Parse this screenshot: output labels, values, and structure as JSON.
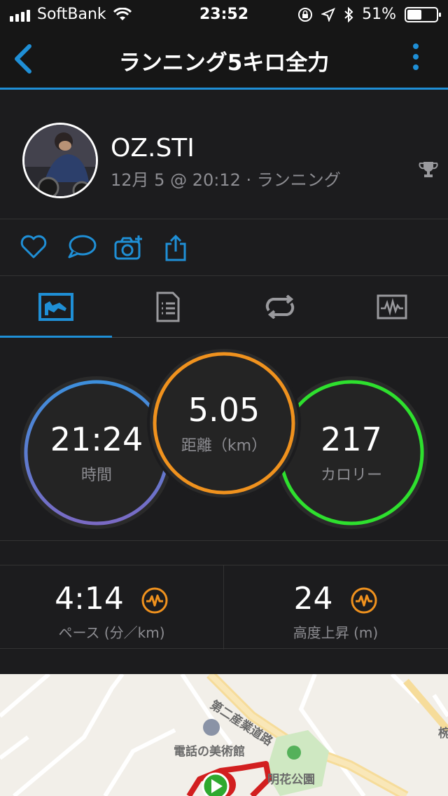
{
  "status_bar": {
    "carrier": "SoftBank",
    "time": "23:52",
    "battery_percent": "51%",
    "battery_level": 0.51
  },
  "nav": {
    "title": "ランニング5キロ全力"
  },
  "profile": {
    "name": "OZ.STI",
    "activity_meta": "12月 5 @ 20:12 · ランニング"
  },
  "tabs": [
    "summary-chart",
    "details",
    "laps",
    "graphs"
  ],
  "metrics": {
    "time": {
      "value": "21:24",
      "label": "時間"
    },
    "distance": {
      "value": "5.05",
      "label": "距離（km）"
    },
    "calories": {
      "value": "217",
      "label": "カロリー"
    }
  },
  "stats": {
    "pace": {
      "value": "4:14",
      "label": "ペース (分／km)"
    },
    "elevation": {
      "value": "24",
      "label": "高度上昇 (m)"
    }
  },
  "map": {
    "labels": {
      "road": "第二産業道路",
      "museum": "電話の美術館",
      "park": "明花公園",
      "edge": "椀"
    }
  },
  "colors": {
    "accent": "#1f8fd6",
    "distance_ring": "#f0921e",
    "calories_ring": "#2ee02e",
    "time_ring_start": "#3d8fdc",
    "time_ring_end": "#7a6ac4",
    "route": "#d21f1f"
  }
}
